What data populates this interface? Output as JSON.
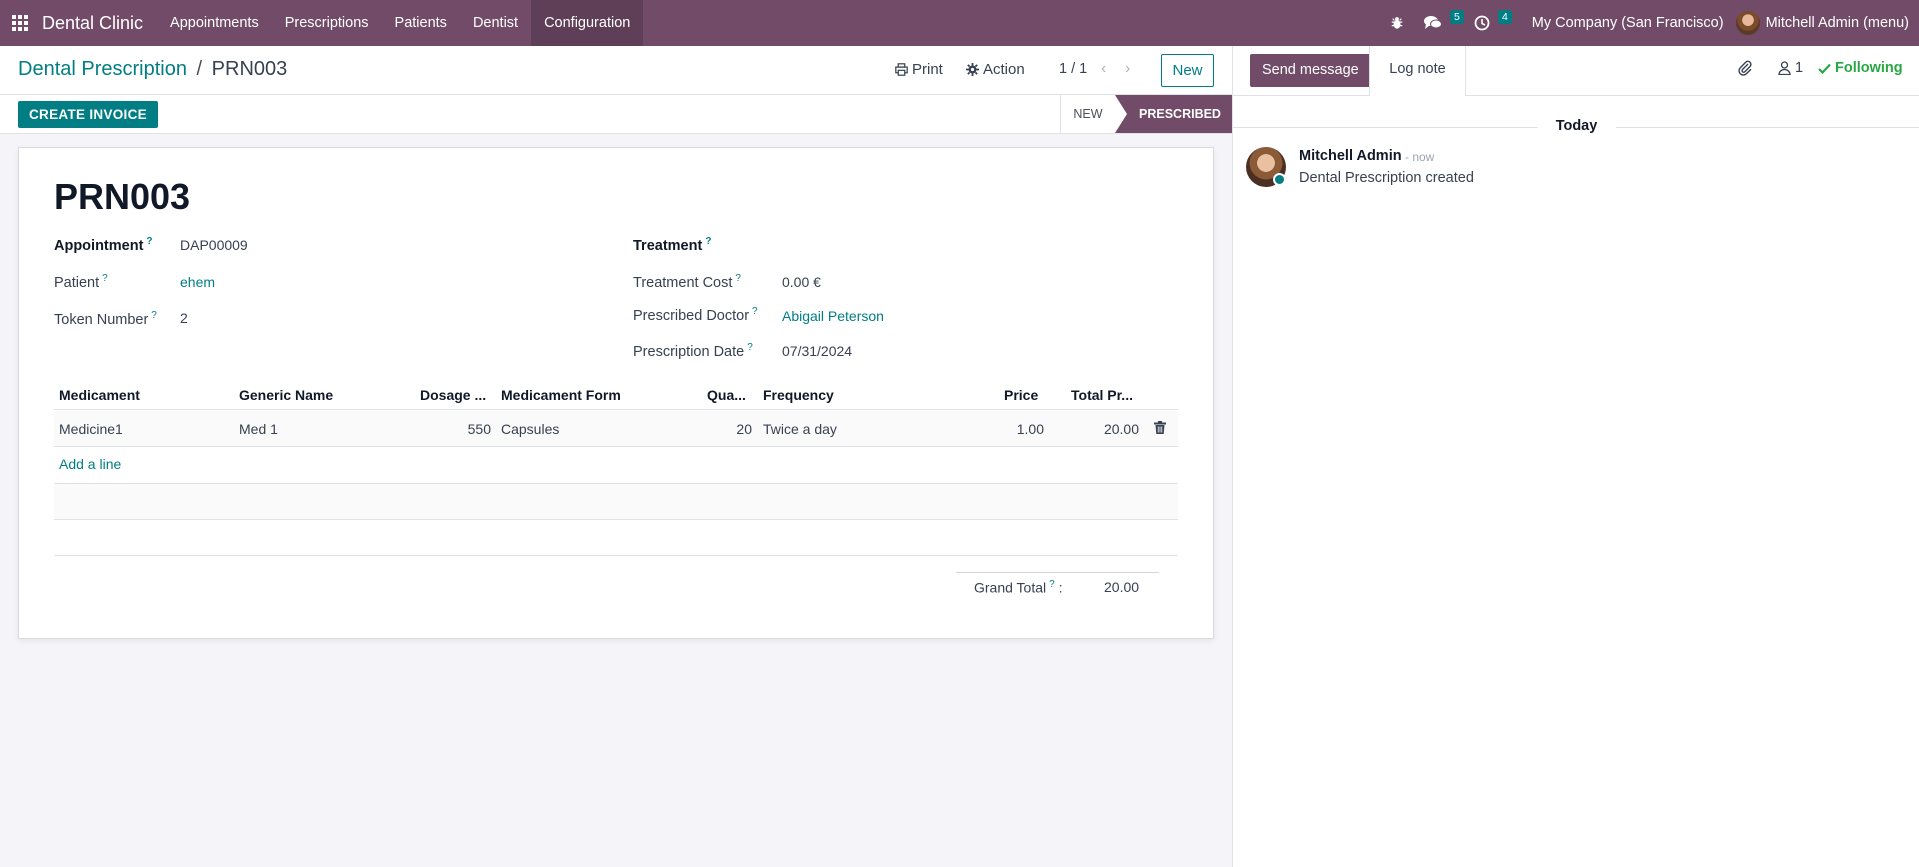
{
  "navbar": {
    "brand": "Dental Clinic",
    "menu": [
      "Appointments",
      "Prescriptions",
      "Patients",
      "Dentist",
      "Configuration"
    ],
    "messages_count": "5",
    "activities_count": "4",
    "company": "My Company (San Francisco)",
    "user": "Mitchell Admin (menu)"
  },
  "control": {
    "breadcrumb_parent": "Dental Prescription",
    "breadcrumb_sep": "/",
    "breadcrumb_current": "PRN003",
    "print_label": "Print",
    "action_label": "Action",
    "pager": "1 / 1",
    "new_label": "New"
  },
  "status": {
    "create_invoice_label": "CREATE INVOICE",
    "stage_new": "NEW",
    "stage_prescribed": "PRESCRIBED"
  },
  "form": {
    "name": "PRN003",
    "appointment_label": "Appointment",
    "appointment_value": "DAP00009",
    "patient_label": "Patient",
    "patient_value": "ehem",
    "token_label": "Token Number",
    "token_value": "2",
    "treatment_label": "Treatment",
    "treatment_cost_label": "Treatment Cost",
    "treatment_cost_value": "0.00 €",
    "doctor_label": "Prescribed Doctor",
    "doctor_value": "Abigail Peterson",
    "date_label": "Prescription Date",
    "date_value": "07/31/2024",
    "help_mark": "?"
  },
  "table": {
    "headers": [
      "Medicament",
      "Generic Name",
      "Dosage ...",
      "Medicament Form",
      "Qua...",
      "Frequency",
      "Price",
      "Total Pr..."
    ],
    "rows": [
      [
        "Medicine1",
        "Med 1",
        "550",
        "Capsules",
        "20",
        "Twice a day",
        "1.00",
        "20.00"
      ]
    ],
    "add_line": "Add a line",
    "grand_total_label": "Grand Total",
    "grand_total_colon": ":",
    "grand_total_value": "20.00"
  },
  "chatter": {
    "send_message": "Send message",
    "log_note": "Log note",
    "followers_count": "1",
    "following": "Following",
    "today": "Today",
    "author": "Mitchell Admin",
    "time": "- now",
    "body": "Dental Prescription created"
  },
  "colors": {
    "brand": "#714b67",
    "accent": "#017e84",
    "success": "#28a745"
  }
}
